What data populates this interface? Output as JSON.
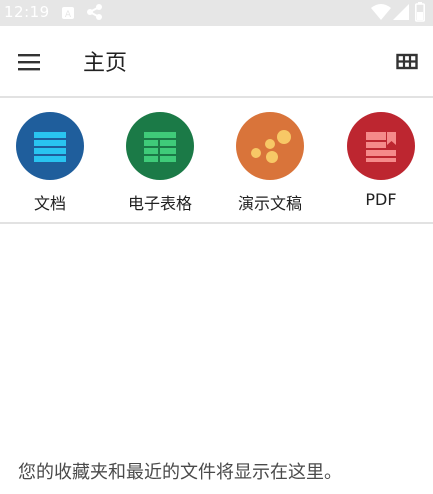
{
  "status_bar": {
    "time": "12:19",
    "icons": [
      "notification-icon",
      "share-icon",
      "wifi-icon",
      "signal-icon",
      "battery-icon"
    ]
  },
  "app_bar": {
    "title": "主页",
    "menu_icon": "menu-icon",
    "grid_icon": "grid-view-icon"
  },
  "quick_actions": [
    {
      "label": "文档",
      "icon": "document-icon",
      "color": "#1f5e9c"
    },
    {
      "label": "电子表格",
      "icon": "spreadsheet-icon",
      "color": "#1b7a47"
    },
    {
      "label": "演示文稿",
      "icon": "presentation-icon",
      "color": "#d9743a"
    },
    {
      "label": "PDF",
      "icon": "pdf-icon",
      "color": "#bd2630"
    }
  ],
  "empty_state": {
    "message": "您的收藏夹和最近的文件将显示在这里。"
  }
}
